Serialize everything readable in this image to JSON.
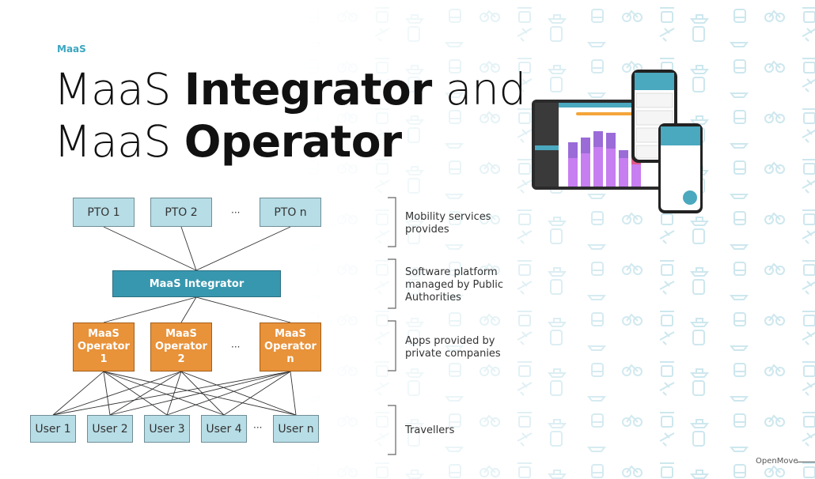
{
  "header": {
    "kicker": "MaaS"
  },
  "title": {
    "line1_light": "MaaS ",
    "line1_bold": "Integrator",
    "line1_tail": " and",
    "line2_light": "MaaS ",
    "line2_bold": "Operator"
  },
  "diagram": {
    "ptos": [
      "PTO 1",
      "PTO 2",
      "PTO n"
    ],
    "integrator": "MaaS Integrator",
    "operators": [
      [
        "MaaS",
        "Operator",
        "1"
      ],
      [
        "MaaS",
        "Operator",
        "2"
      ],
      [
        "MaaS",
        "Operator",
        "n"
      ]
    ],
    "users": [
      "User 1",
      "User 2",
      "User 3",
      "User 4",
      "User n"
    ],
    "ellipsis": "···",
    "colors": {
      "pto": "#b7dde6",
      "integrator": "#3797ae",
      "operator": "#e8923a"
    }
  },
  "legend": {
    "mobility": [
      "Mobility services",
      "provides"
    ],
    "platform": [
      "Software platform",
      "managed by Public",
      "Authorities"
    ],
    "apps": [
      "Apps provided by",
      "private companies"
    ],
    "travellers": [
      "Travellers"
    ]
  },
  "footer": {
    "brand": "OpenMove"
  },
  "accent_color": "#3ba6c0"
}
